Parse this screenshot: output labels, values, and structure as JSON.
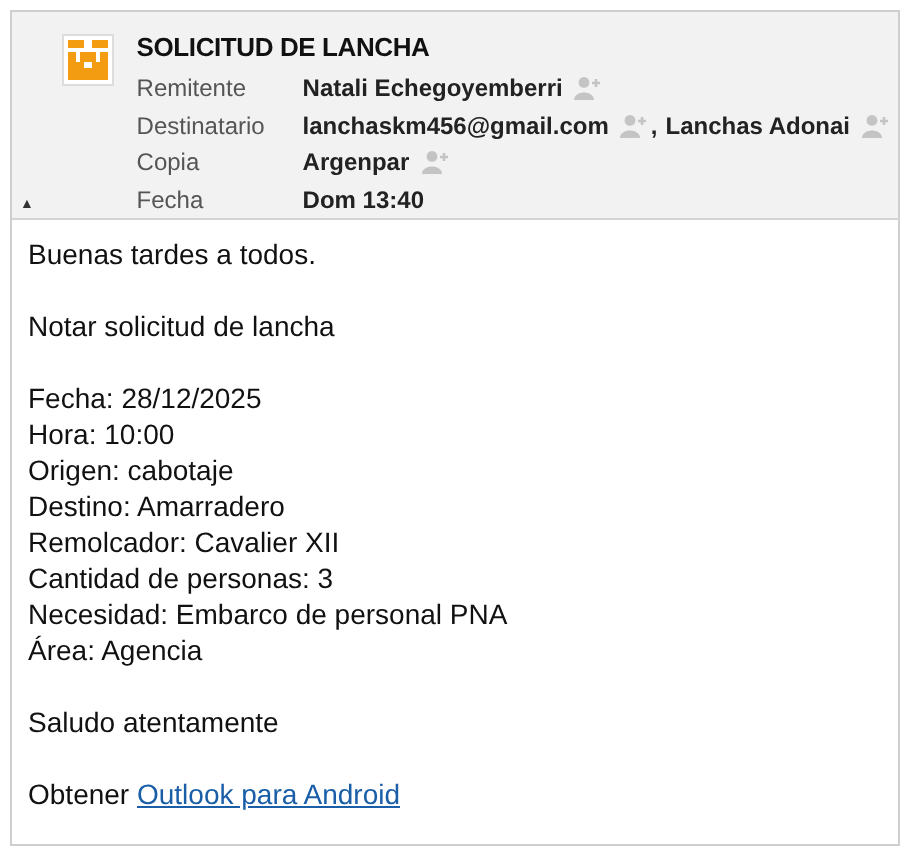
{
  "header": {
    "subject": "SOLICITUD DE LANCHA",
    "collapse_toggle": "▲",
    "fields": [
      {
        "label": "Remitente",
        "kind": "contacts",
        "contacts": [
          "Natali Echegoyemberri"
        ]
      },
      {
        "label": "Destinatario",
        "kind": "contacts",
        "contacts": [
          "lanchaskm456@gmail.com",
          "Lanchas Adonai"
        ],
        "separator": ","
      },
      {
        "label": "Copia",
        "kind": "contacts",
        "contacts": [
          "Argenpar"
        ]
      },
      {
        "label": "Fecha",
        "kind": "text",
        "value": "Dom 13:40"
      }
    ]
  },
  "body": {
    "paragraphs": [
      [
        "Buenas tardes a todos."
      ],
      [
        "Notar solicitud de lancha"
      ],
      [
        "Fecha: 28/12/2025",
        "Hora: 10:00",
        "Origen: cabotaje",
        "Destino: Amarradero",
        "Remolcador: Cavalier XII",
        "Cantidad de personas: 3",
        "Necesidad: Embarco de personal PNA",
        "Área: Agencia"
      ],
      [
        "Saludo atentamente"
      ]
    ],
    "footer": {
      "text": "Obtener",
      "link": "Outlook para Android"
    }
  }
}
